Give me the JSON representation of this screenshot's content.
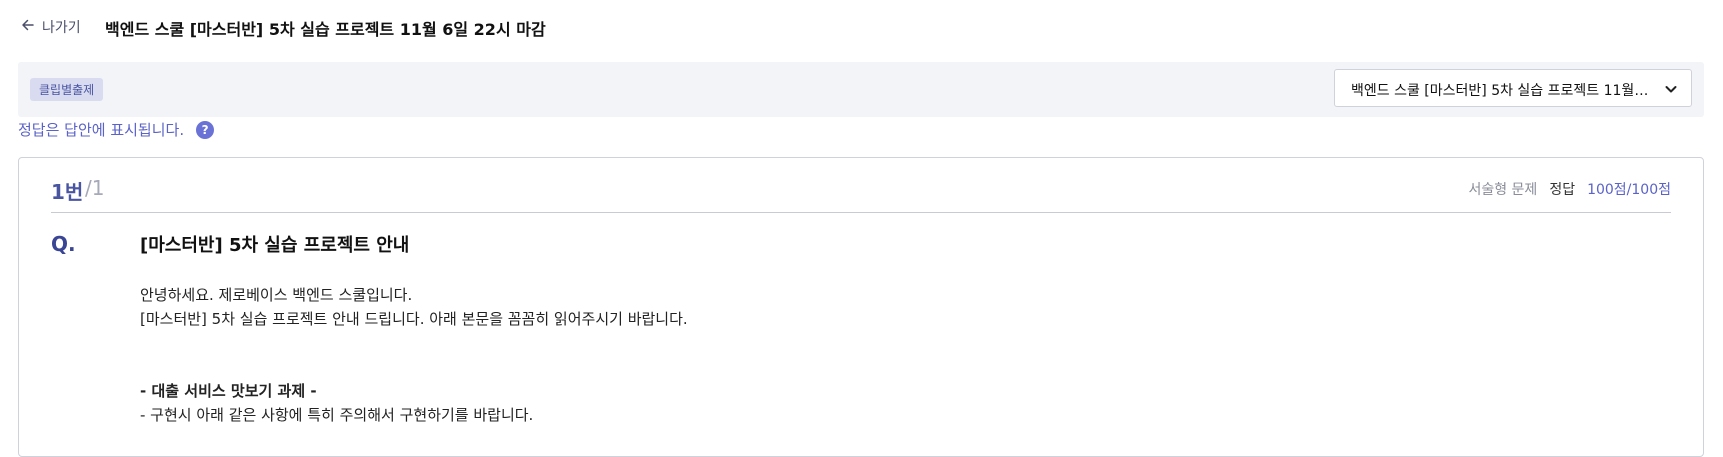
{
  "topbar": {
    "back_label": "나가기",
    "title": "백엔드 스쿨 [마스터반] 5차 실습 프로젝트 11월 6일 22시 마감"
  },
  "filter": {
    "tag_label": "클립별출제",
    "selected_exam": "백엔드 스쿨 [마스터반] 5차 실습 프로젝트 11월 6…"
  },
  "notice": {
    "text": "정답은 답안에 표시됩니다.",
    "help_glyph": "?"
  },
  "question": {
    "number": "1번",
    "total": "/1",
    "type": "서술형 문제",
    "answer_label": "정답",
    "score": "100점/100점",
    "q_label": "Q.",
    "title": "[마스터반] 5차 실습 프로젝트 안내",
    "body_line1": "안녕하세요. 제로베이스 백엔드 스쿨입니다.",
    "body_line2": "[마스터반] 5차 실습 프로젝트 안내 드립니다. 아래 본문을 꼼꼼히 읽어주시기 바랍니다.",
    "section_heading": "- 대출 서비스 맛보기 과제 -",
    "section_line1": "- 구현시 아래 같은 사항에 특히 주의해서 구현하기를 바랍니다."
  },
  "icons": {
    "back": "arrow-left-icon",
    "dropdown": "chevron-down-icon",
    "help": "question-circle-icon"
  },
  "colors": {
    "accent": "#5b63c8",
    "accent_dark": "#4a55a2",
    "tag_bg": "#d9dcf0",
    "filter_bg": "#f3f4f8"
  }
}
